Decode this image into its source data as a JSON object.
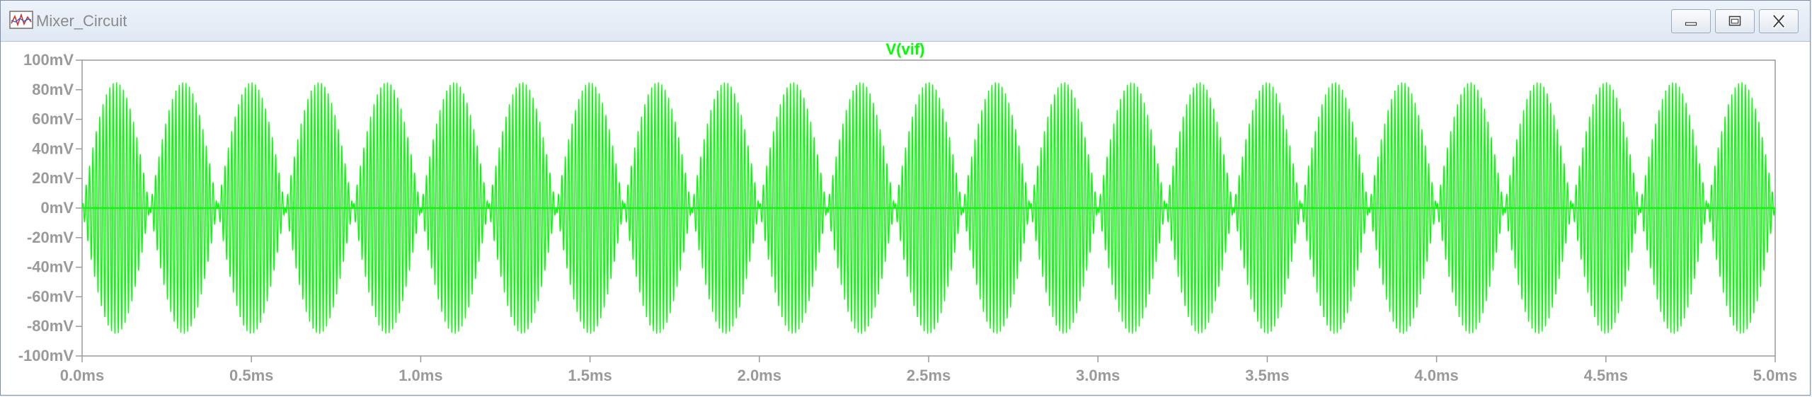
{
  "window": {
    "title": "Mixer_Circuit",
    "app_icon": "waveform-viewer-icon",
    "controls": {
      "minimize": "minimize-icon",
      "maximize": "maximize-icon",
      "close": "close-icon"
    }
  },
  "colors": {
    "trace": "#00ff00",
    "axis_text": "#9a9a9a",
    "frame": "#9a9a9a",
    "background": "#ffffff"
  },
  "chart_data": {
    "type": "line",
    "title": "V(vif)",
    "series": [
      {
        "name": "V(vif)",
        "description": "double-sideband mixer output: 100 kHz carrier modulated by 2.5 kHz envelope, peak ~85 mV",
        "amplitude_mV": 85,
        "envelope_freq_kHz": 2.5,
        "carrier_freq_kHz": 100,
        "color": "#00ff00"
      }
    ],
    "xlabel": "",
    "ylabel": "",
    "xlim": [
      0,
      5
    ],
    "ylim": [
      -100,
      100
    ],
    "x_ticks": [
      "0.0ms",
      "0.5ms",
      "1.0ms",
      "1.5ms",
      "2.0ms",
      "2.5ms",
      "3.0ms",
      "3.5ms",
      "4.0ms",
      "4.5ms",
      "5.0ms"
    ],
    "y_ticks": [
      "100mV",
      "80mV",
      "60mV",
      "40mV",
      "20mV",
      "0mV",
      "-20mV",
      "-40mV",
      "-60mV",
      "-80mV",
      "-100mV"
    ],
    "grid": false
  }
}
